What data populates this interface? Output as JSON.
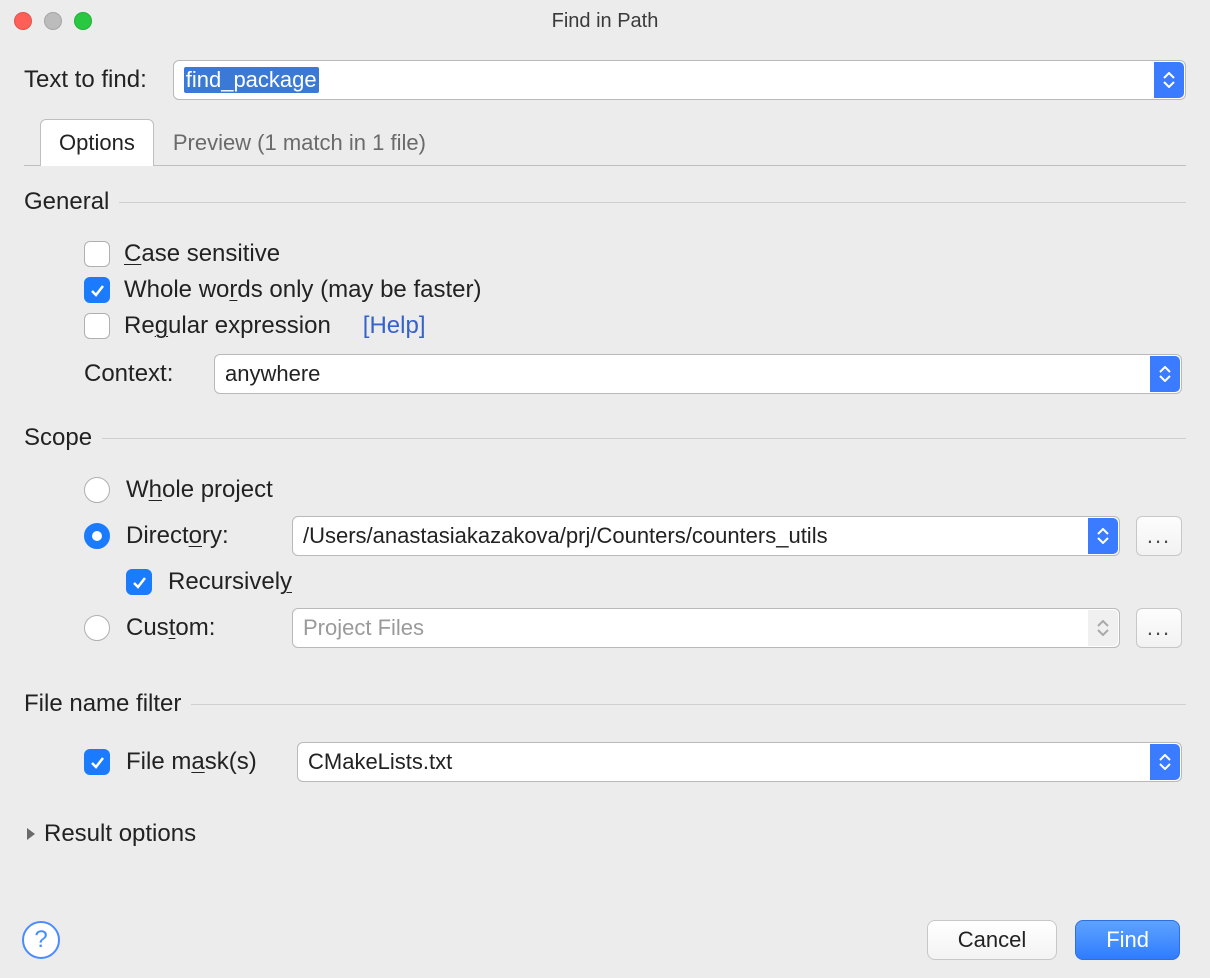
{
  "window": {
    "title": "Find in Path"
  },
  "search": {
    "label": "Text to find:",
    "value": "find_package"
  },
  "tabs": {
    "options": "Options",
    "preview": "Preview (1 match in 1 file)"
  },
  "general": {
    "heading": "General",
    "case_sensitive": "Case sensitive",
    "whole_words": "Whole words only (may be faster)",
    "regex": "Regular expression",
    "help": "[Help]",
    "context_label": "Context:",
    "context_value": "anywhere"
  },
  "scope": {
    "heading": "Scope",
    "whole_project": "Whole project",
    "directory_label": "Directory:",
    "directory_value": "/Users/anastasiakazakova/prj/Counters/counters_utils",
    "recursively": "Recursively",
    "custom_label": "Custom:",
    "custom_value": "Project Files"
  },
  "file_filter": {
    "heading": "File name filter",
    "mask_label": "File mask(s)",
    "mask_value": "CMakeLists.txt"
  },
  "result_options": "Result options",
  "buttons": {
    "cancel": "Cancel",
    "find": "Find"
  }
}
